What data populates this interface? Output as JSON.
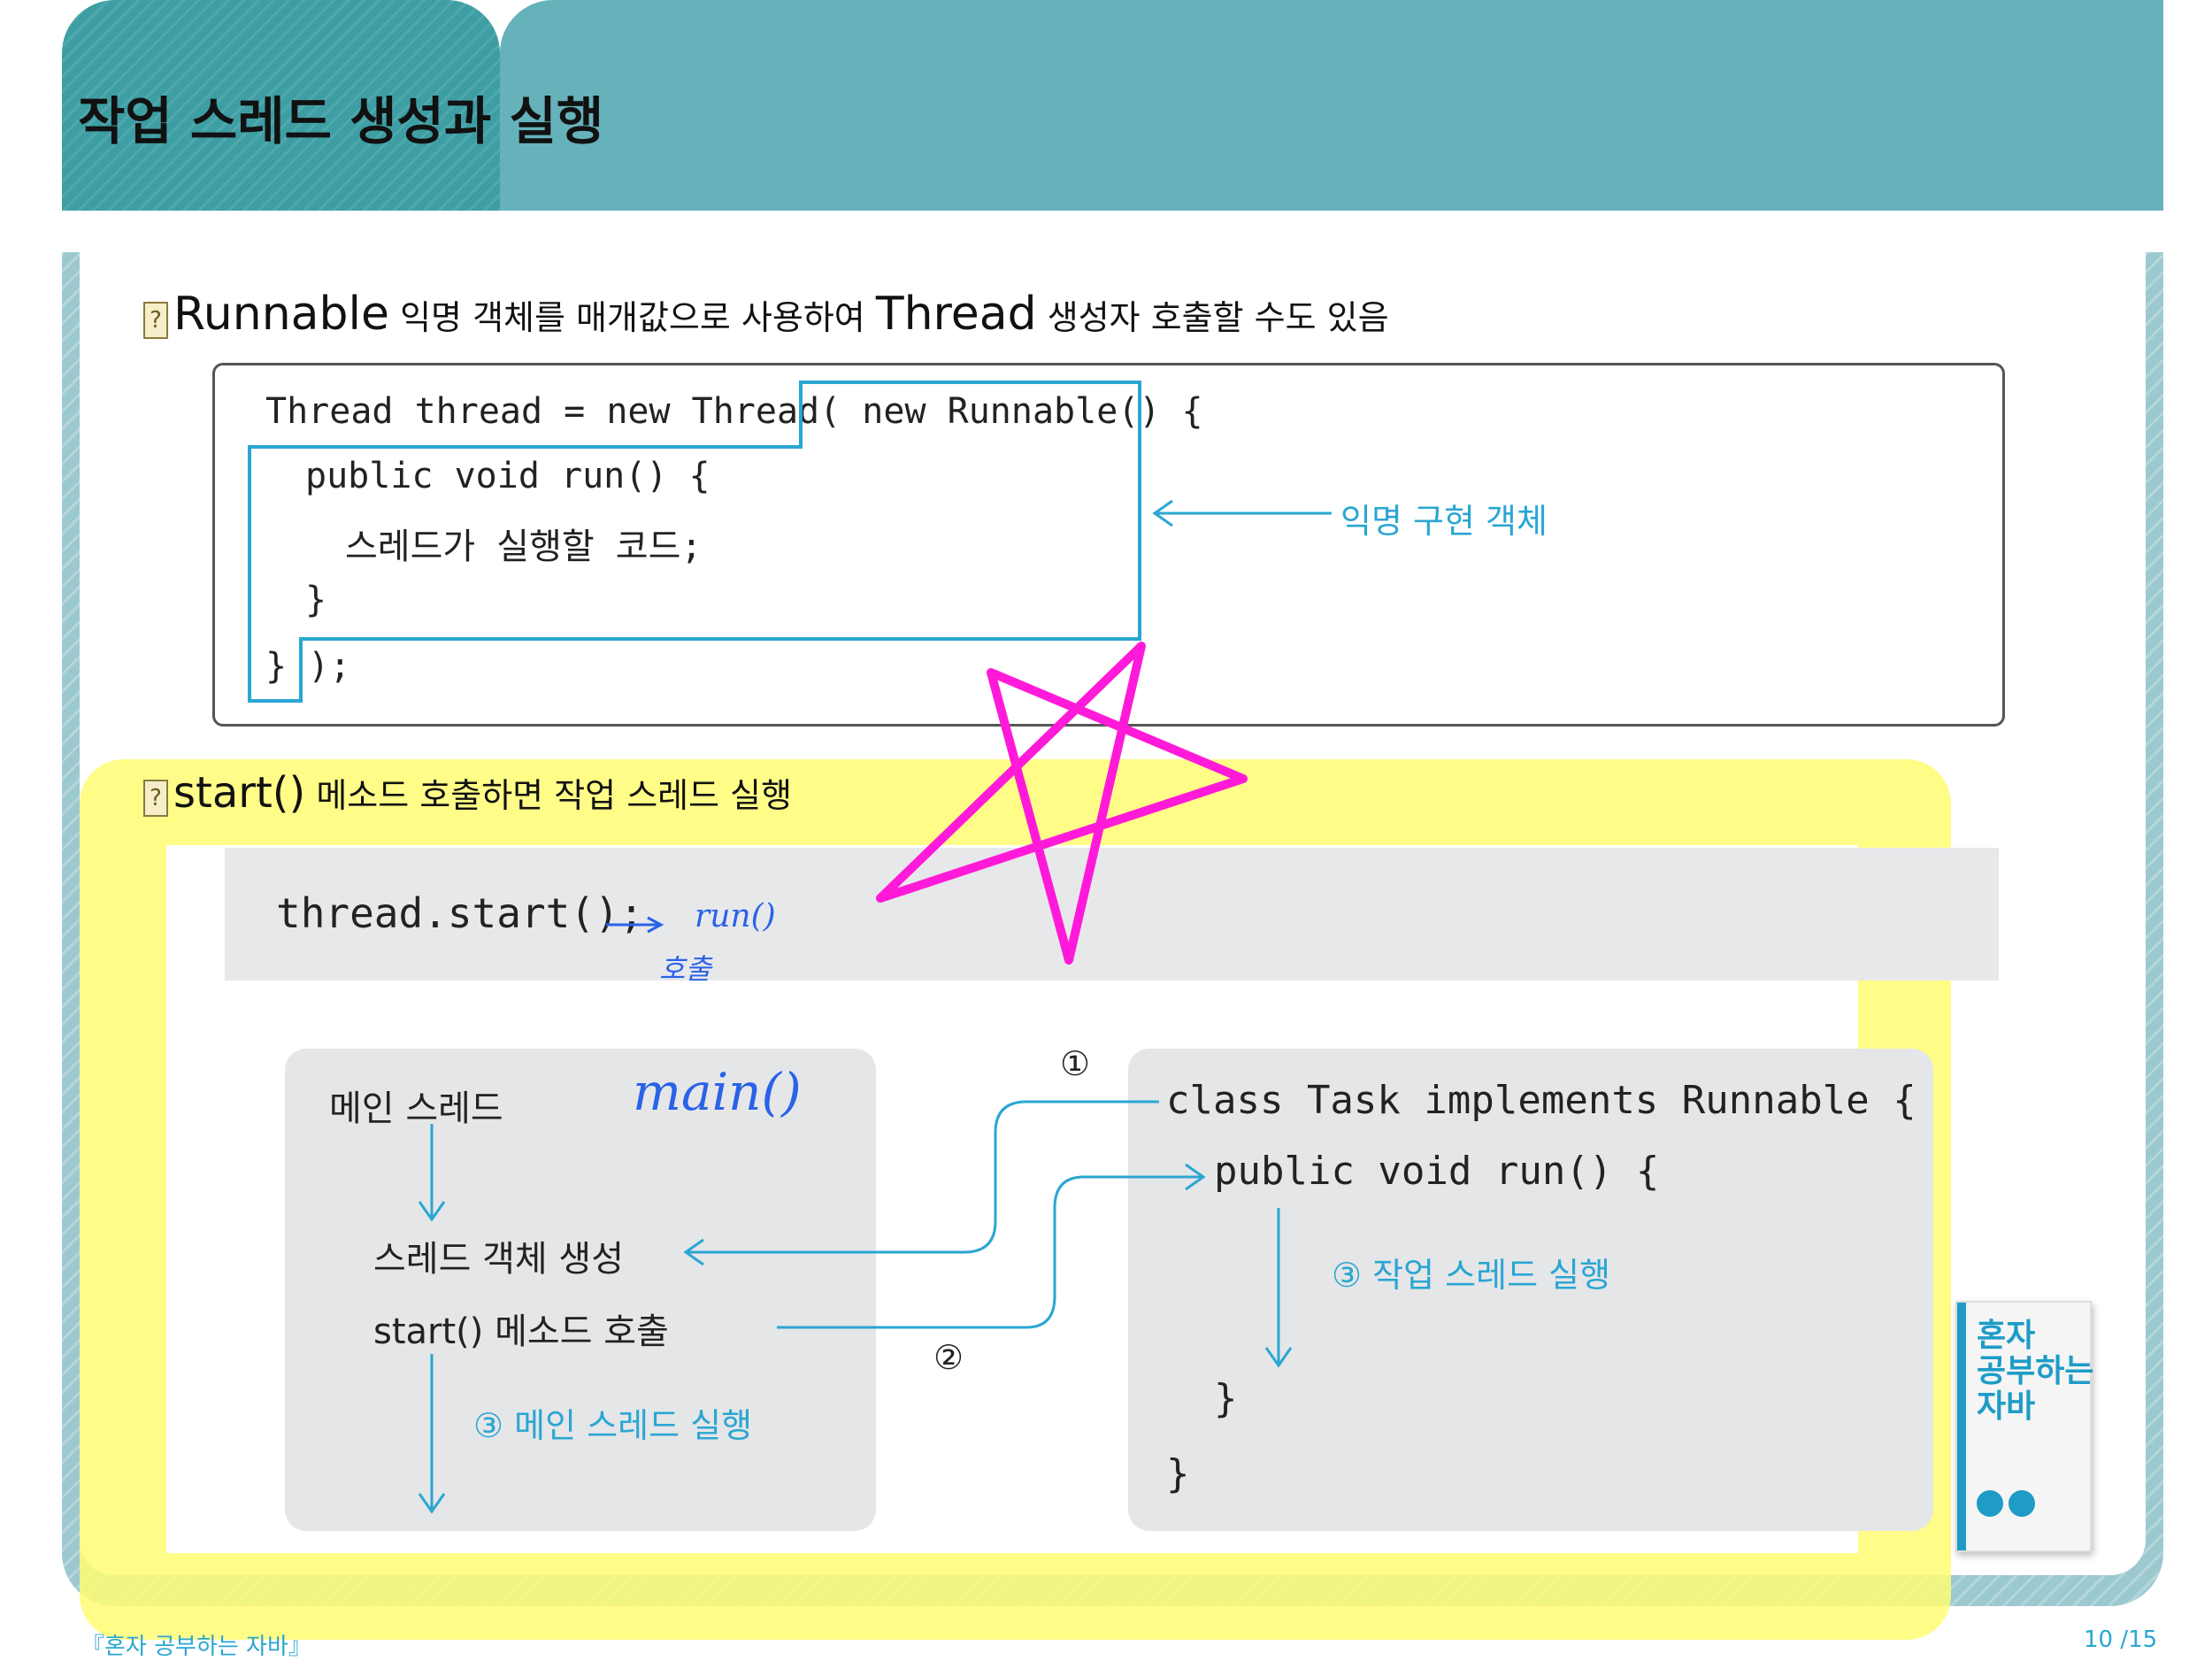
{
  "header": {
    "title": "작업 스레드 생성과 실행"
  },
  "section1": {
    "bullet_icon": "?",
    "text_a": "Runnable",
    "text_b": " 익명 객체를 매개값으로 사용하여 ",
    "text_c": "Thread",
    "text_d": " 생성자 호출할 수도 있음",
    "code": [
      "Thread thread = new Thread( new Runnable() {",
      "public void run() {",
      "스레드가 실행할 코드;",
      "}",
      "} );"
    ],
    "annotation": "익명 구현 객체"
  },
  "section2": {
    "bullet_icon": "?",
    "text_a": "start()",
    "text_b": " 메소드 호출하면 작업 스레드 실행",
    "command": "thread.start();",
    "main_box": {
      "title": "메인 스레드",
      "create": "스레드 객체 생성",
      "start": "start() 메소드 호출",
      "run_label": "③ 메인 스레드 실행"
    },
    "task_box": {
      "line1": "class Task implements Runnable {",
      "line2": "public void run() {",
      "run_label": "③ 작업 스레드 실행",
      "close1": "}",
      "close2": "}"
    },
    "step1": "①",
    "step2": "②"
  },
  "handwriting": {
    "run": "run()",
    "call": "호출",
    "main": "main()",
    "star_color": "#ff1ad9"
  },
  "book": {
    "title": "혼자\n공부하는\n자바"
  },
  "footer": {
    "left": "『혼자 공부하는 자바』",
    "page": "10 /15"
  },
  "colors": {
    "teal_dark": "#3d9ea4",
    "teal_light": "#66b2bb",
    "accent_blue": "#2aa6d2",
    "highlight": "#fffd73"
  }
}
